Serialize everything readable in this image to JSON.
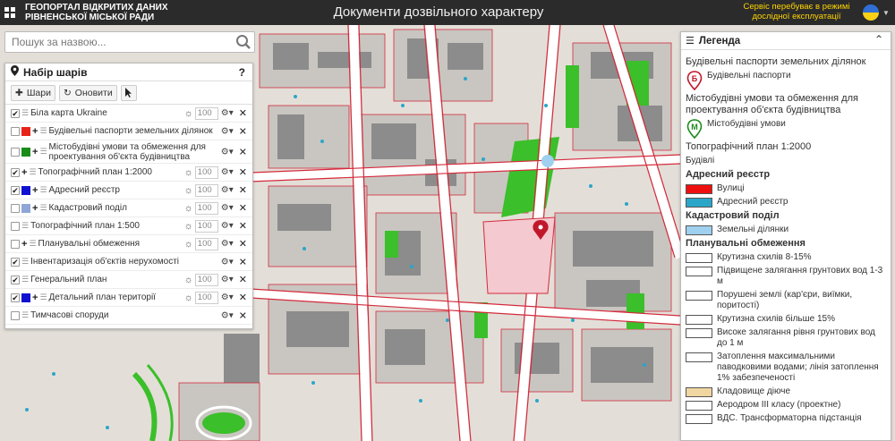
{
  "header": {
    "org_name": "Геопортал відкритих даних Рівненської міської ради",
    "page_title": "Документи дозвільного характеру",
    "notice": "Сервіс перебуває в режимі дослідної експлуатації"
  },
  "search": {
    "placeholder": "Пошук за назвою..."
  },
  "layers_panel": {
    "title": "Набір шарів",
    "help": "?",
    "tools": {
      "layers_label": "Шари",
      "refresh_label": "Оновити"
    },
    "rows": [
      {
        "label": "Біла карта Ukraine",
        "checked": true,
        "swatch": "",
        "plus": false,
        "opacity": "100",
        "sun": true
      },
      {
        "label": "Будівельні паспорти земельних ділянок",
        "checked": false,
        "swatch": "#e8241a",
        "plus": true,
        "opacity": "",
        "sun": false
      },
      {
        "label": "Містобудівні умови та обмеження для проектування об'єкта будівництва",
        "checked": false,
        "swatch": "#1a8c1a",
        "plus": true,
        "opacity": "",
        "sun": false
      },
      {
        "label": "Топографічний план 1:2000",
        "checked": true,
        "swatch": "",
        "plus": true,
        "opacity": "100",
        "sun": true
      },
      {
        "label": "Адресний реєстр",
        "checked": true,
        "swatch": "#1010d0",
        "plus": true,
        "opacity": "100",
        "sun": true
      },
      {
        "label": "Кадастровий поділ",
        "checked": false,
        "swatch": "#8fa6d8",
        "plus": true,
        "opacity": "100",
        "sun": true
      },
      {
        "label": "Топографічний план 1:500",
        "checked": false,
        "swatch": "",
        "plus": false,
        "opacity": "100",
        "sun": true
      },
      {
        "label": "Планувальні обмеження",
        "checked": false,
        "swatch": "",
        "plus": true,
        "opacity": "100",
        "sun": true
      },
      {
        "label": "Інвентаризація об'єктів нерухомості",
        "checked": true,
        "swatch": "",
        "plus": false,
        "opacity": "",
        "sun": false
      },
      {
        "label": "Генеральний план",
        "checked": true,
        "swatch": "",
        "plus": false,
        "opacity": "100",
        "sun": true
      },
      {
        "label": "Детальний план території",
        "checked": true,
        "swatch": "#1010d0",
        "plus": true,
        "opacity": "100",
        "sun": true
      },
      {
        "label": "Тимчасові споруди",
        "checked": false,
        "swatch": "",
        "plus": false,
        "opacity": "",
        "sun": false
      }
    ]
  },
  "legend": {
    "title": "Легенда",
    "s1_title": "Будівельні паспорти земельних ділянок",
    "s1_mark": "Б",
    "s1_item": "Будівельні паспорти",
    "s2_title": "Містобудівні умови та обмеження для проектування об'єкта будівництва",
    "s2_mark": "М",
    "s2_item": "Містобудівні умови",
    "s3_title": "Топографічний план 1:2000",
    "s3_item": "Будівлі",
    "s4_title": "Адресний реєстр",
    "s4_items": [
      {
        "label": "Вулиці",
        "color": "#ee1010"
      },
      {
        "label": "Адресний реєстр",
        "color": "#2aa6c8"
      }
    ],
    "s5_title": "Кадастровий поділ",
    "s5_item": {
      "label": "Земельні ділянки",
      "color": "#9fd0f0"
    },
    "s6_title": "Планувальні обмеження",
    "s6_items": [
      {
        "label": "Крутизна схилів 8-15%",
        "color": "#ffffff"
      },
      {
        "label": "Підвищене залягання грунтових вод 1-3 м",
        "color": "#ffffff"
      },
      {
        "label": "Порушені землі (кар'єри, виїмки, поритості)",
        "color": "#ffffff"
      },
      {
        "label": "Крутизна схилів більше 15%",
        "color": "#ffffff"
      },
      {
        "label": "Високе залягання рівня грунтових вод до 1 м",
        "color": "#ffffff"
      },
      {
        "label": "Затоплення максимальними паводковими водами; лінія затоплення 1% забезпеченості",
        "color": "#ffffff"
      },
      {
        "label": "Кладовище діюче",
        "color": "#f0d6a0"
      },
      {
        "label": "Аеродром III класу (проектне)",
        "color": "#ffffff"
      },
      {
        "label": "ВДС. Трансформаторна підстанція",
        "color": "#ffffff"
      }
    ]
  },
  "colors": {
    "header_bg": "#2b2b2b",
    "notice": "#ffd400",
    "street_red": "#d42a3c",
    "park_green": "#3bbf2a",
    "building_gray": "#8c8c8c",
    "map_marker": "#c0182a"
  }
}
